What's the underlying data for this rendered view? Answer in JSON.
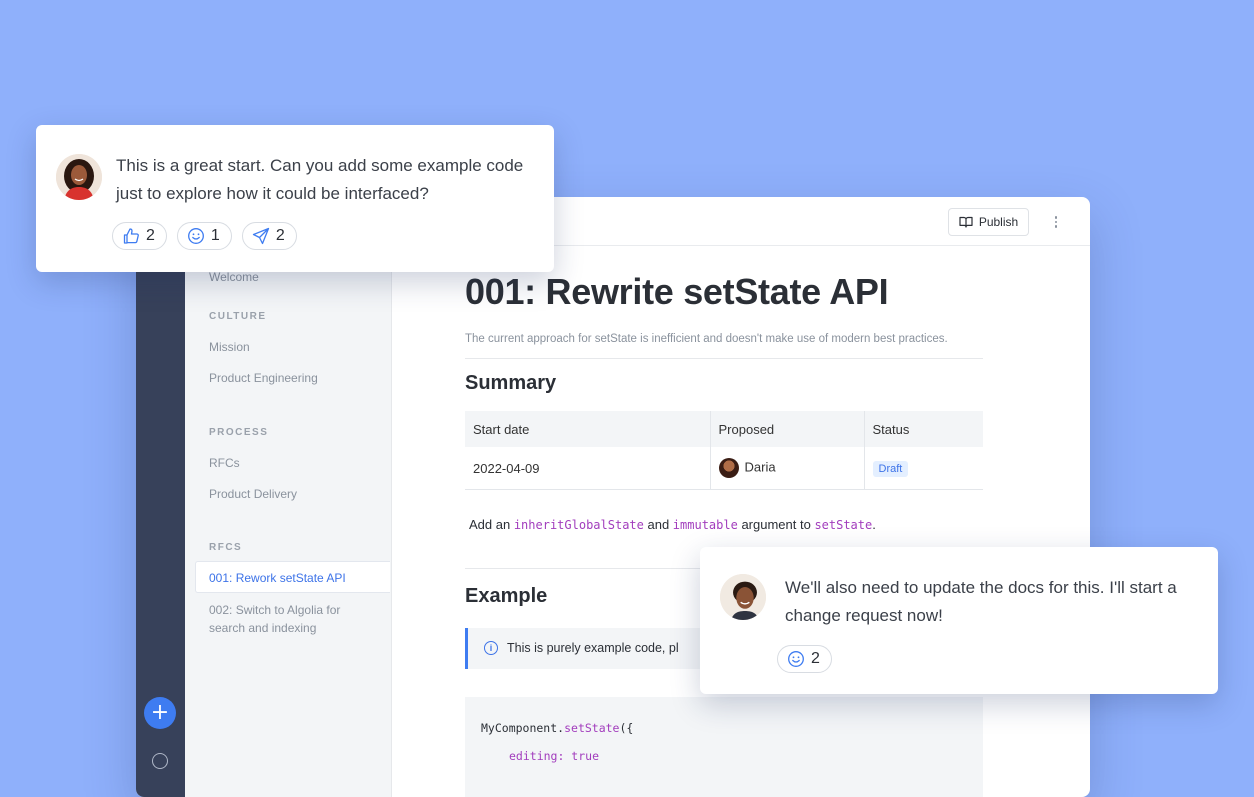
{
  "sidebar": {
    "items": {
      "welcome": "Welcome",
      "culture_heading": "CULTURE",
      "mission": "Mission",
      "product_engineering": "Product Engineering",
      "process_heading": "PROCESS",
      "rfcs": "RFCs",
      "product_delivery": "Product Delivery",
      "rfcs_heading": "RFCS",
      "rfc_001": "001: Rework setState API",
      "rfc_002": "002: Switch to Algolia for search and indexing"
    },
    "add_label": "+"
  },
  "toolbar": {
    "publish_label": "Publish"
  },
  "document": {
    "title": "001: Rewrite setState API",
    "description": "The current approach for setState is inefficient and doesn't make use of modern best practices.",
    "summary_heading": "Summary",
    "table": {
      "headers": [
        "Start date",
        "Proposed",
        "Status"
      ],
      "row": {
        "start_date": "2022-04-09",
        "proposed": "Daria",
        "status": "Draft"
      }
    },
    "paragraph": {
      "part1": "Add an ",
      "code1": "inheritGlobalState",
      "part2": " and ",
      "code2": "immutable",
      "part3": " argument to ",
      "code3": "setState",
      "part4": "."
    },
    "example_heading": "Example",
    "callout_text": "This is purely example code, pl",
    "code": {
      "line1_obj": "MyComponent.",
      "line1_fn": "setState",
      "line1_end": "({",
      "line2": "editing: true"
    }
  },
  "comments": [
    {
      "text": "This is a great start. Can you add some example code just to explore how it could be interfaced?",
      "reactions": {
        "thumbs_up": "2",
        "smile": "1",
        "send": "2"
      }
    },
    {
      "text": "We'll also need to update the docs for this. I'll start a change request now!",
      "reactions": {
        "smile": "2"
      }
    }
  ],
  "colors": {
    "background": "#8fb0fb",
    "accent": "#3e7cf1",
    "rail": "#37415a",
    "code": "#a23dbd"
  }
}
